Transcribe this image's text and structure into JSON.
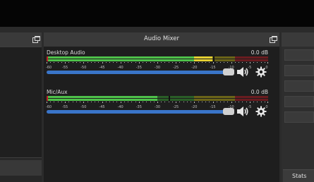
{
  "mixer": {
    "title": "Audio Mixer",
    "channels": [
      {
        "name": "Desktop Audio",
        "db": "0.0 dB",
        "level_db": -15,
        "peak_db": -15,
        "volume_fraction": 0.96,
        "muted": false
      },
      {
        "name": "Mic/Aux",
        "db": "0.0 dB",
        "level_db": -30,
        "peak_db": -27,
        "volume_fraction": 0.96,
        "muted": false
      }
    ],
    "ticks": [
      "-60",
      "-55",
      "-50",
      "-45",
      "-40",
      "-35",
      "-30",
      "-25",
      "-20",
      "-15",
      "-10",
      "-5",
      "0"
    ]
  },
  "controls": {
    "stats_label": "Stats"
  },
  "colors": {
    "green": "#4ec24a",
    "green_dim": "#2a5e27",
    "yellow": "#e5d032",
    "yellow_dim": "#6b6418",
    "red": "#d8343e",
    "red_dim": "#6a1c20",
    "slider": "#3a75c9"
  },
  "icons": [
    "float-icon",
    "speaker-icon",
    "gear-icon"
  ]
}
